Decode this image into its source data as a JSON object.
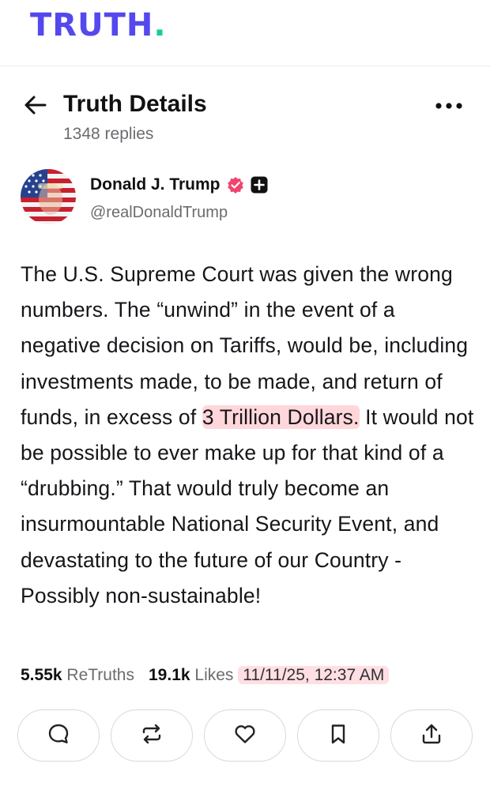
{
  "app": {
    "logo_text": "TRUTH",
    "logo_dot": ".",
    "brand_color": "#5448ee",
    "dot_color": "#17c9a1"
  },
  "header": {
    "title": "Truth Details",
    "replies": "1348 replies",
    "back_icon": "arrow-left-icon",
    "more_icon": "more-horizontal-icon"
  },
  "author": {
    "name": "Donald J. Trump",
    "handle": "@realDonaldTrump",
    "verified_icon": "verified-badge-icon",
    "verified_color": "#f0446c",
    "plus_icon": "plus-badge-icon"
  },
  "post": {
    "text_before": "The U.S. Supreme Court was given the wrong numbers. The “unwind” in the event of a negative decision on Tariffs, would be, including investments made, to be made, and return of funds, in excess of ",
    "highlight": "3 Trillion Dollars.",
    "text_after": " It would not be possible to ever make up for that kind of a “drubbing.” That would truly become an insurmountable National Security Event, and devastating to the future of our Country - Possibly non-sustainable!",
    "highlight_color": "#ffb0b8"
  },
  "stats": {
    "retruths_count": "5.55k",
    "retruths_label": "ReTruths",
    "likes_count": "19.1k",
    "likes_label": "Likes",
    "timestamp": "11/11/25, 12:37 AM"
  },
  "actions": [
    {
      "icon": "reply-icon"
    },
    {
      "icon": "retruth-icon"
    },
    {
      "icon": "heart-icon"
    },
    {
      "icon": "bookmark-icon"
    },
    {
      "icon": "share-icon"
    }
  ]
}
